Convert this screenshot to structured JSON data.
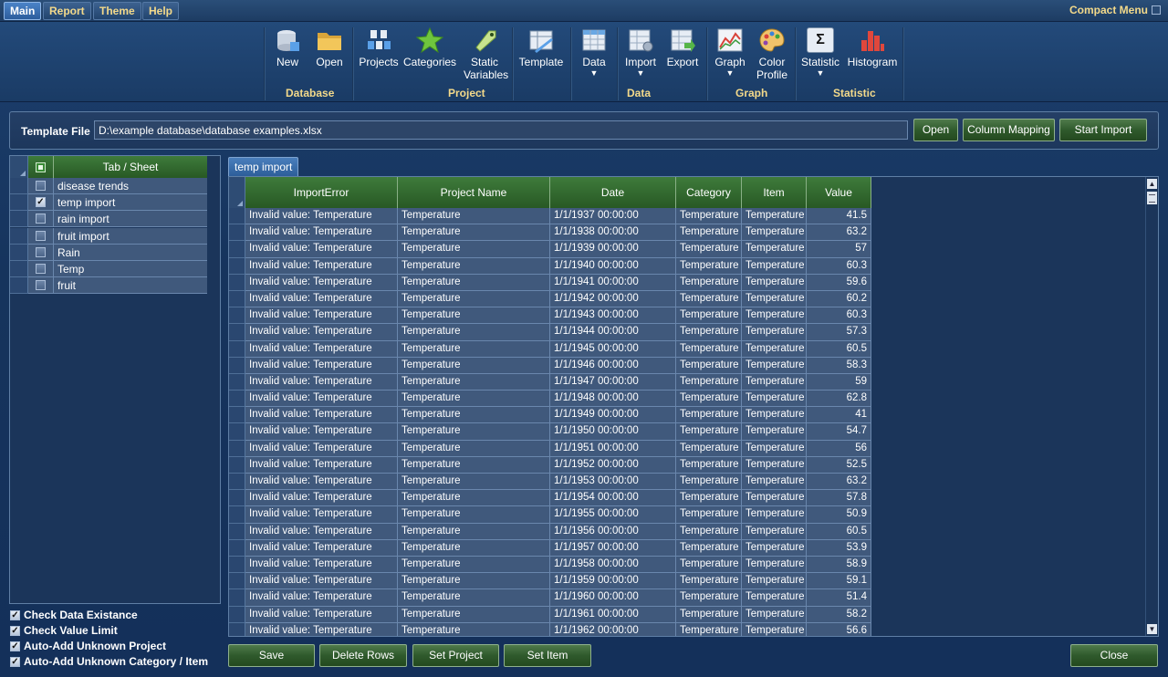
{
  "menu": {
    "tabs": [
      {
        "label": "Main",
        "active": true
      },
      {
        "label": "Report",
        "active": false
      },
      {
        "label": "Theme",
        "active": false
      },
      {
        "label": "Help",
        "active": false
      }
    ],
    "compact_menu": "Compact Menu"
  },
  "ribbon": {
    "buttons": {
      "new": "New",
      "open": "Open",
      "projects": "Projects",
      "categories": "Categories",
      "static_variables_1": "Static",
      "static_variables_2": "Variables",
      "template": "Template",
      "data": "Data",
      "import": "Import",
      "export": "Export",
      "graph": "Graph",
      "color_profile_1": "Color",
      "color_profile_2": "Profile",
      "statistic": "Statistic",
      "histogram": "Histogram"
    },
    "groups": {
      "database": "Database",
      "project": "Project",
      "data": "Data",
      "graph": "Graph",
      "statistic": "Statistic"
    },
    "dropdown_arrow": "▼",
    "sigma": "Σ"
  },
  "template_file": {
    "label": "Template File :",
    "value": "D:\\example database\\database examples.xlsx",
    "open_label": "Open",
    "column_mapping_label": "Column Mapping",
    "start_import_label": "Start Import"
  },
  "sheets": {
    "header": "Tab / Sheet",
    "items": [
      {
        "label": "disease trends",
        "checked": false
      },
      {
        "label": "temp import",
        "checked": true
      },
      {
        "label": "rain import",
        "checked": false
      },
      {
        "label": "fruit import",
        "checked": false
      },
      {
        "label": "Rain",
        "checked": false
      },
      {
        "label": "Temp",
        "checked": false
      },
      {
        "label": "fruit",
        "checked": false
      }
    ]
  },
  "options": [
    {
      "label": "Check Data Existance",
      "checked": true
    },
    {
      "label": "Check Value Limit",
      "checked": true
    },
    {
      "label": "Auto-Add Unknown Project",
      "checked": true
    },
    {
      "label": "Auto-Add Unknown Category / Item",
      "checked": true
    }
  ],
  "data_tab": "temp import",
  "grid": {
    "columns": [
      "ImportError",
      "Project Name",
      "Date",
      "Category",
      "Item",
      "Value"
    ],
    "rows": [
      [
        "Invalid value: Temperature",
        "Temperature",
        "1/1/1937  00:00:00",
        "Temperature",
        "Temperature",
        "41.5"
      ],
      [
        "Invalid value: Temperature",
        "Temperature",
        "1/1/1938  00:00:00",
        "Temperature",
        "Temperature",
        "63.2"
      ],
      [
        "Invalid value: Temperature",
        "Temperature",
        "1/1/1939  00:00:00",
        "Temperature",
        "Temperature",
        "57"
      ],
      [
        "Invalid value: Temperature",
        "Temperature",
        "1/1/1940  00:00:00",
        "Temperature",
        "Temperature",
        "60.3"
      ],
      [
        "Invalid value: Temperature",
        "Temperature",
        "1/1/1941  00:00:00",
        "Temperature",
        "Temperature",
        "59.6"
      ],
      [
        "Invalid value: Temperature",
        "Temperature",
        "1/1/1942  00:00:00",
        "Temperature",
        "Temperature",
        "60.2"
      ],
      [
        "Invalid value: Temperature",
        "Temperature",
        "1/1/1943  00:00:00",
        "Temperature",
        "Temperature",
        "60.3"
      ],
      [
        "Invalid value: Temperature",
        "Temperature",
        "1/1/1944  00:00:00",
        "Temperature",
        "Temperature",
        "57.3"
      ],
      [
        "Invalid value: Temperature",
        "Temperature",
        "1/1/1945  00:00:00",
        "Temperature",
        "Temperature",
        "60.5"
      ],
      [
        "Invalid value: Temperature",
        "Temperature",
        "1/1/1946  00:00:00",
        "Temperature",
        "Temperature",
        "58.3"
      ],
      [
        "Invalid value: Temperature",
        "Temperature",
        "1/1/1947  00:00:00",
        "Temperature",
        "Temperature",
        "59"
      ],
      [
        "Invalid value: Temperature",
        "Temperature",
        "1/1/1948  00:00:00",
        "Temperature",
        "Temperature",
        "62.8"
      ],
      [
        "Invalid value: Temperature",
        "Temperature",
        "1/1/1949  00:00:00",
        "Temperature",
        "Temperature",
        "41"
      ],
      [
        "Invalid value: Temperature",
        "Temperature",
        "1/1/1950  00:00:00",
        "Temperature",
        "Temperature",
        "54.7"
      ],
      [
        "Invalid value: Temperature",
        "Temperature",
        "1/1/1951  00:00:00",
        "Temperature",
        "Temperature",
        "56"
      ],
      [
        "Invalid value: Temperature",
        "Temperature",
        "1/1/1952  00:00:00",
        "Temperature",
        "Temperature",
        "52.5"
      ],
      [
        "Invalid value: Temperature",
        "Temperature",
        "1/1/1953  00:00:00",
        "Temperature",
        "Temperature",
        "63.2"
      ],
      [
        "Invalid value: Temperature",
        "Temperature",
        "1/1/1954  00:00:00",
        "Temperature",
        "Temperature",
        "57.8"
      ],
      [
        "Invalid value: Temperature",
        "Temperature",
        "1/1/1955  00:00:00",
        "Temperature",
        "Temperature",
        "50.9"
      ],
      [
        "Invalid value: Temperature",
        "Temperature",
        "1/1/1956  00:00:00",
        "Temperature",
        "Temperature",
        "60.5"
      ],
      [
        "Invalid value: Temperature",
        "Temperature",
        "1/1/1957  00:00:00",
        "Temperature",
        "Temperature",
        "53.9"
      ],
      [
        "Invalid value: Temperature",
        "Temperature",
        "1/1/1958  00:00:00",
        "Temperature",
        "Temperature",
        "58.9"
      ],
      [
        "Invalid value: Temperature",
        "Temperature",
        "1/1/1959  00:00:00",
        "Temperature",
        "Temperature",
        "59.1"
      ],
      [
        "Invalid value: Temperature",
        "Temperature",
        "1/1/1960  00:00:00",
        "Temperature",
        "Temperature",
        "51.4"
      ],
      [
        "Invalid value: Temperature",
        "Temperature",
        "1/1/1961  00:00:00",
        "Temperature",
        "Temperature",
        "58.2"
      ],
      [
        "Invalid value: Temperature",
        "Temperature",
        "1/1/1962  00:00:00",
        "Temperature",
        "Temperature",
        "56.6"
      ]
    ]
  },
  "footer": {
    "save_label": "Save",
    "delete_rows_label": "Delete Rows",
    "set_project_label": "Set Project",
    "set_item_label": "Set Item",
    "close_label": "Close"
  },
  "colors": {
    "background": "#16345d",
    "accent_text": "#f3d98a",
    "grid_header": "#3e7b3b",
    "grid_cell": "#40597c",
    "button_green": "#2f5a2c"
  }
}
